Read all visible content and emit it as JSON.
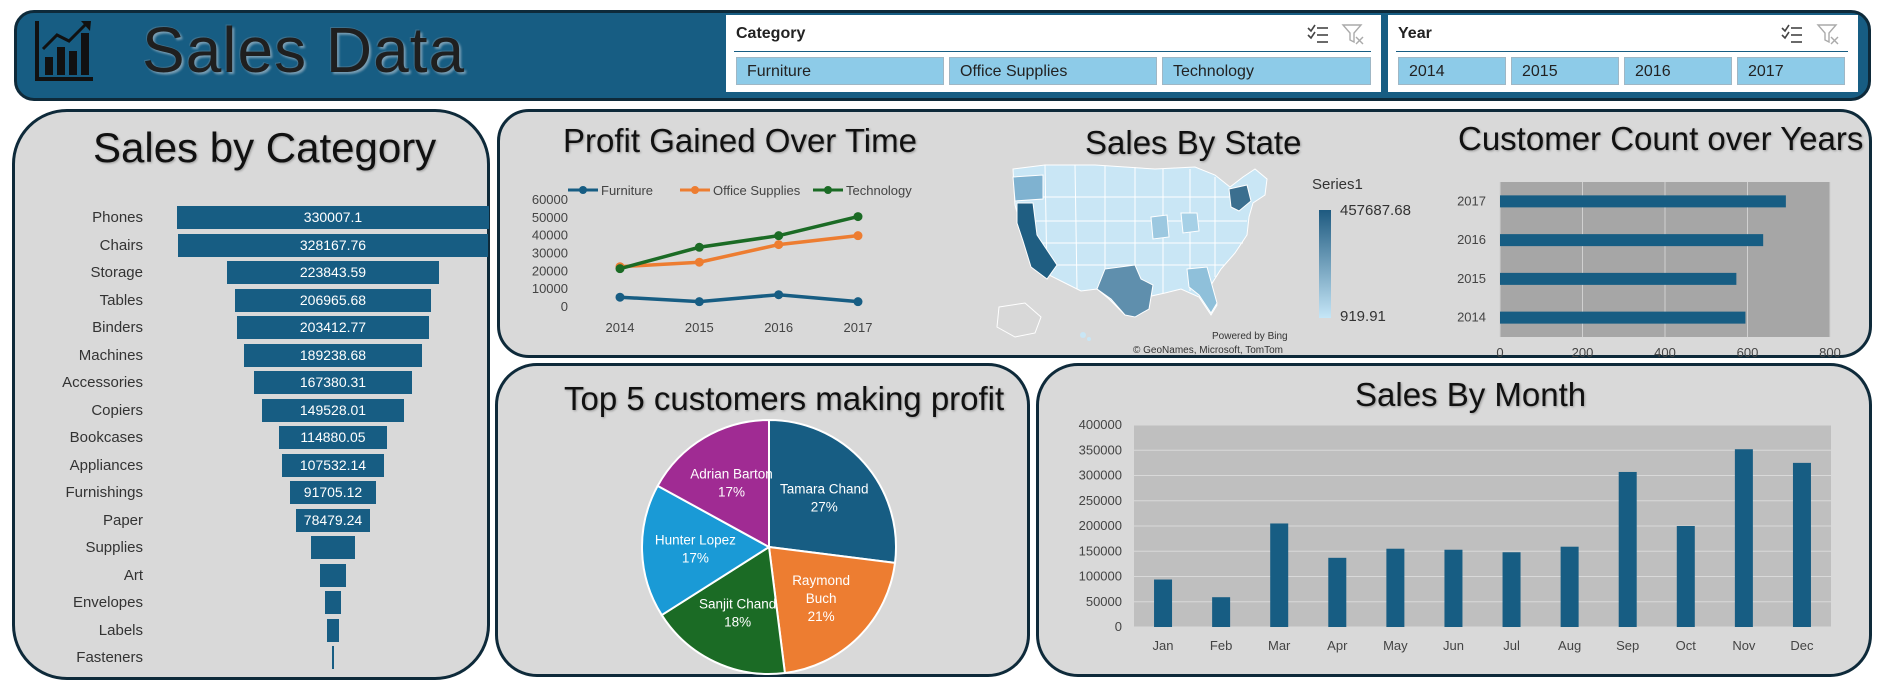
{
  "header": {
    "title": "Sales Data"
  },
  "slicers": {
    "category": {
      "title": "Category",
      "items": [
        "Furniture",
        "Office Supplies",
        "Technology"
      ]
    },
    "year": {
      "title": "Year",
      "items": [
        "2014",
        "2015",
        "2016",
        "2017"
      ]
    }
  },
  "colors": {
    "primary": "#175d83",
    "furniture": "#175d83",
    "office": "#ed7d31",
    "technology": "#1b6b25",
    "panel": "#d9d9d9"
  },
  "chart_data": [
    {
      "type": "bar",
      "variant": "funnel",
      "title": "Sales by Category",
      "categories": [
        "Phones",
        "Chairs",
        "Storage",
        "Tables",
        "Binders",
        "Machines",
        "Accessories",
        "Copiers",
        "Bookcases",
        "Appliances",
        "Furnishings",
        "Paper",
        "Supplies",
        "Art",
        "Envelopes",
        "Labels",
        "Fasteners"
      ],
      "values": [
        330007.1,
        328167.76,
        223843.59,
        206965.68,
        203412.77,
        189238.68,
        167380.31,
        149528.01,
        114880.05,
        107532.14,
        91705.12,
        78479.24,
        46673.54,
        27118.79,
        16476.4,
        12486.31,
        3024.28
      ],
      "labels": [
        "330007.1",
        "328167.76",
        "223843.59",
        "206965.68",
        "203412.77",
        "189238.68",
        "167380.31",
        "149528.01",
        "114880.05",
        "107532.14",
        "91705.12",
        "78479.24",
        "",
        "",
        "",
        "",
        ""
      ]
    },
    {
      "type": "line",
      "title": "Profit Gained Over Time",
      "x": [
        "2014",
        "2015",
        "2016",
        "2017"
      ],
      "series": [
        {
          "name": "Furniture",
          "values": [
            5500,
            3000,
            6900,
            3000
          ]
        },
        {
          "name": "Office Supplies",
          "values": [
            22600,
            25100,
            35000,
            40000
          ]
        },
        {
          "name": "Technology",
          "values": [
            21500,
            33500,
            40000,
            50700
          ]
        }
      ],
      "ylim": [
        0,
        60000
      ],
      "yticks": [
        "60000",
        "50000",
        "40000",
        "30000",
        "20000",
        "10000",
        "0"
      ]
    },
    {
      "type": "heatmap",
      "variant": "map",
      "title": "Sales By State",
      "legend_title": "Series1",
      "max_label": "457687.68",
      "min_label": "919.91",
      "credit1": "Powered by Bing",
      "credit2": "© GeoNames, Microsoft, TomTom"
    },
    {
      "type": "bar",
      "orientation": "horizontal",
      "title": "Customer Count over Years",
      "categories": [
        "2017",
        "2016",
        "2015",
        "2014"
      ],
      "values": [
        693,
        638,
        573,
        595
      ],
      "xlim": [
        0,
        800
      ],
      "xticks": [
        "0",
        "200",
        "400",
        "600",
        "800"
      ]
    },
    {
      "type": "pie",
      "title": "Top 5 customers making profit",
      "labels": [
        "Tamara Chand",
        "Raymond Buch",
        "Sanjit Chand",
        "Hunter Lopez",
        "Adrian Barton"
      ],
      "values": [
        27,
        21,
        18,
        17,
        17
      ],
      "percent_labels": [
        "27%",
        "21%",
        "18%",
        "17%",
        "17%"
      ],
      "colors": [
        "#175d83",
        "#ed7d31",
        "#1b6b25",
        "#1a9ad6",
        "#a02b93"
      ]
    },
    {
      "type": "bar",
      "title": "Sales By Month",
      "categories": [
        "Jan",
        "Feb",
        "Mar",
        "Apr",
        "May",
        "Jun",
        "Jul",
        "Aug",
        "Sep",
        "Oct",
        "Nov",
        "Dec"
      ],
      "values": [
        94000,
        59000,
        205000,
        137000,
        155000,
        153000,
        148000,
        159000,
        307000,
        200000,
        352000,
        325000
      ],
      "ylim": [
        0,
        400000
      ],
      "yticks": [
        "400000",
        "350000",
        "300000",
        "250000",
        "200000",
        "150000",
        "100000",
        "50000",
        "0"
      ]
    }
  ]
}
